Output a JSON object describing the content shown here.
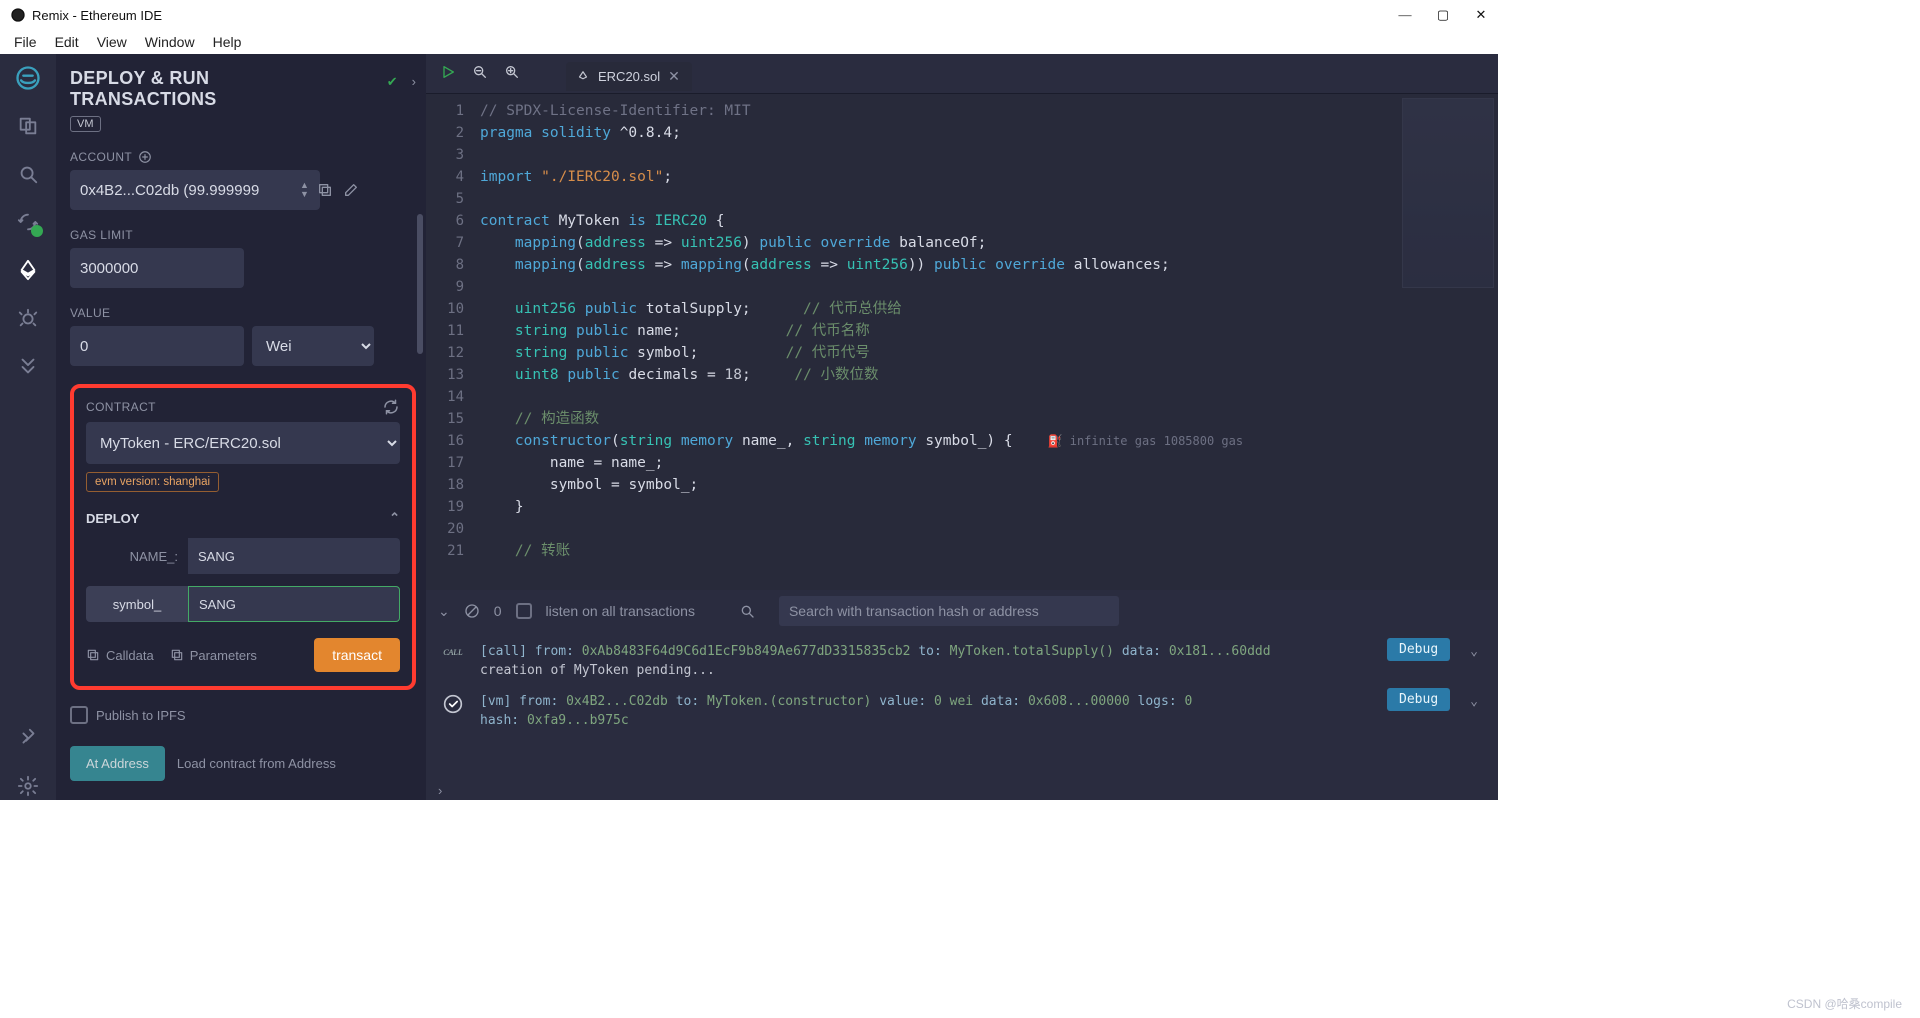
{
  "window": {
    "title": "Remix - Ethereum IDE"
  },
  "menubar": [
    "File",
    "Edit",
    "View",
    "Window",
    "Help"
  ],
  "icons": [
    "logo",
    "files",
    "search",
    "reload",
    "deploy",
    "bug",
    "double-chevron",
    "plug",
    "settings"
  ],
  "panel": {
    "title_l1": "DEPLOY & RUN",
    "title_l2": "TRANSACTIONS",
    "vm": "VM",
    "account_label": "ACCOUNT",
    "account": "0x4B2...C02db (99.999999",
    "gas_label": "GAS LIMIT",
    "gas": "3000000",
    "value_label": "VALUE",
    "value": "0",
    "value_unit": "Wei",
    "contract_label": "CONTRACT",
    "contract": "MyToken - ERC/ERC20.sol",
    "evm": "evm version: shanghai",
    "deploy_label": "DEPLOY",
    "params": [
      {
        "label": "NAME_:",
        "value": "SANG"
      },
      {
        "label": "symbol_",
        "value": "SANG"
      }
    ],
    "calldata": "Calldata",
    "parameters": "Parameters",
    "transact": "transact",
    "publish": "Publish to IPFS",
    "at_address": "At Address",
    "load_address": "Load contract from Address"
  },
  "tab": {
    "name": "ERC20.sol"
  },
  "code_lines": [
    {
      "n": 1,
      "html": "<span class='c-cm'>// SPDX-License-Identifier: MIT</span>"
    },
    {
      "n": 2,
      "html": "<span class='c-kw'>pragma</span> <span class='c-kw'>solidity</span> <span class='c-id'>^0.8.4</span><span class='c-pu'>;</span>"
    },
    {
      "n": 3,
      "html": ""
    },
    {
      "n": 4,
      "html": "<span class='c-kw'>import</span> <span class='c-str'>\"./IERC20.sol\"</span><span class='c-pu'>;</span>"
    },
    {
      "n": 5,
      "html": ""
    },
    {
      "n": 6,
      "html": "<span class='c-kw'>contract</span> <span class='c-id'>MyToken</span> <span class='c-kw'>is</span> <span class='c-ty'>IERC20</span> <span class='c-pu'>{</span>"
    },
    {
      "n": 7,
      "html": "    <span class='c-kw'>mapping</span><span class='c-pu'>(</span><span class='c-ty'>address</span> <span class='c-pu'>=&gt;</span> <span class='c-ty'>uint256</span><span class='c-pu'>)</span> <span class='c-kw'>public</span> <span class='c-kw'>override</span> <span class='c-id'>balanceOf</span><span class='c-pu'>;</span>"
    },
    {
      "n": 8,
      "html": "    <span class='c-kw'>mapping</span><span class='c-pu'>(</span><span class='c-ty'>address</span> <span class='c-pu'>=&gt;</span> <span class='c-kw'>mapping</span><span class='c-pu'>(</span><span class='c-ty'>address</span> <span class='c-pu'>=&gt;</span> <span class='c-ty'>uint256</span><span class='c-pu'>))</span> <span class='c-kw'>public</span> <span class='c-kw'>override</span> <span class='c-id'>allowances</span><span class='c-pu'>;</span>"
    },
    {
      "n": 9,
      "html": ""
    },
    {
      "n": 10,
      "html": "    <span class='c-ty'>uint256</span> <span class='c-kw'>public</span> <span class='c-id'>totalSupply</span><span class='c-pu'>;</span>      <span class='c-cmg'>// 代币总供给</span>"
    },
    {
      "n": 11,
      "html": "    <span class='c-ty'>string</span> <span class='c-kw'>public</span> <span class='c-id'>name</span><span class='c-pu'>;</span>            <span class='c-cmg'>// 代币名称</span>"
    },
    {
      "n": 12,
      "html": "    <span class='c-ty'>string</span> <span class='c-kw'>public</span> <span class='c-id'>symbol</span><span class='c-pu'>;</span>          <span class='c-cmg'>// 代币代号</span>"
    },
    {
      "n": 13,
      "html": "    <span class='c-ty'>uint8</span> <span class='c-kw'>public</span> <span class='c-id'>decimals</span> <span class='c-pu'>=</span> <span class='c-num'>18</span><span class='c-pu'>;</span>     <span class='c-cmg'>// 小数位数</span>"
    },
    {
      "n": 14,
      "html": ""
    },
    {
      "n": 15,
      "html": "    <span class='c-cmg'>// 构造函数</span>"
    },
    {
      "n": 16,
      "html": "    <span class='c-kw'>constructor</span><span class='c-pu'>(</span><span class='c-ty'>string</span> <span class='c-kw'>memory</span> <span class='c-id'>name_</span><span class='c-pu'>,</span> <span class='c-ty'>string</span> <span class='c-kw'>memory</span> <span class='c-id'>symbol_</span><span class='c-pu'>)</span> <span class='c-pu'>{</span>    <span class='hint'>⛽ infinite gas 1085800 gas</span>"
    },
    {
      "n": 17,
      "html": "        <span class='c-id'>name</span> <span class='c-pu'>=</span> <span class='c-id'>name_</span><span class='c-pu'>;</span>"
    },
    {
      "n": 18,
      "html": "        <span class='c-id'>symbol</span> <span class='c-pu'>=</span> <span class='c-id'>symbol_</span><span class='c-pu'>;</span>"
    },
    {
      "n": 19,
      "html": "    <span class='c-pu'>}</span>"
    },
    {
      "n": 20,
      "html": ""
    },
    {
      "n": 21,
      "html": "    <span class='c-cmg'>// 转账</span>"
    }
  ],
  "terminal": {
    "count": "0",
    "listen": "listen on all transactions",
    "search_placeholder": "Search with transaction hash or address",
    "logs": [
      {
        "icon": "call",
        "lines": [
          "<span class='lg-k'>[call]</span>  <span class='lg-k'>from:</span> <span class='lg-v'>0xAb8483F64d9C6d1EcF9b849Ae677dD3315835cb2</span> <span class='lg-k'>to:</span> <span class='lg-v'>MyToken.totalSupply()</span> <span class='lg-k'>data:</span> <span class='lg-v'>0x181...60ddd</span>",
          "creation of MyToken pending..."
        ],
        "debug": true
      },
      {
        "icon": "check",
        "lines": [
          "<span class='lg-k'>[vm]</span>  <span class='lg-k'>from:</span> <span class='lg-v'>0x4B2...C02db</span> <span class='lg-k'>to:</span> <span class='lg-v'>MyToken.(constructor)</span> <span class='lg-k'>value:</span> <span class='lg-v'>0 wei</span> <span class='lg-k'>data:</span> <span class='lg-v'>0x608...00000</span> <span class='lg-k'>logs:</span> <span class='lg-v'>0</span>",
          "<span class='lg-k'>hash:</span> <span class='lg-v'>0xfa9...b975c</span>"
        ],
        "debug": true
      }
    ]
  },
  "footer": "CSDN @哈桑compile"
}
